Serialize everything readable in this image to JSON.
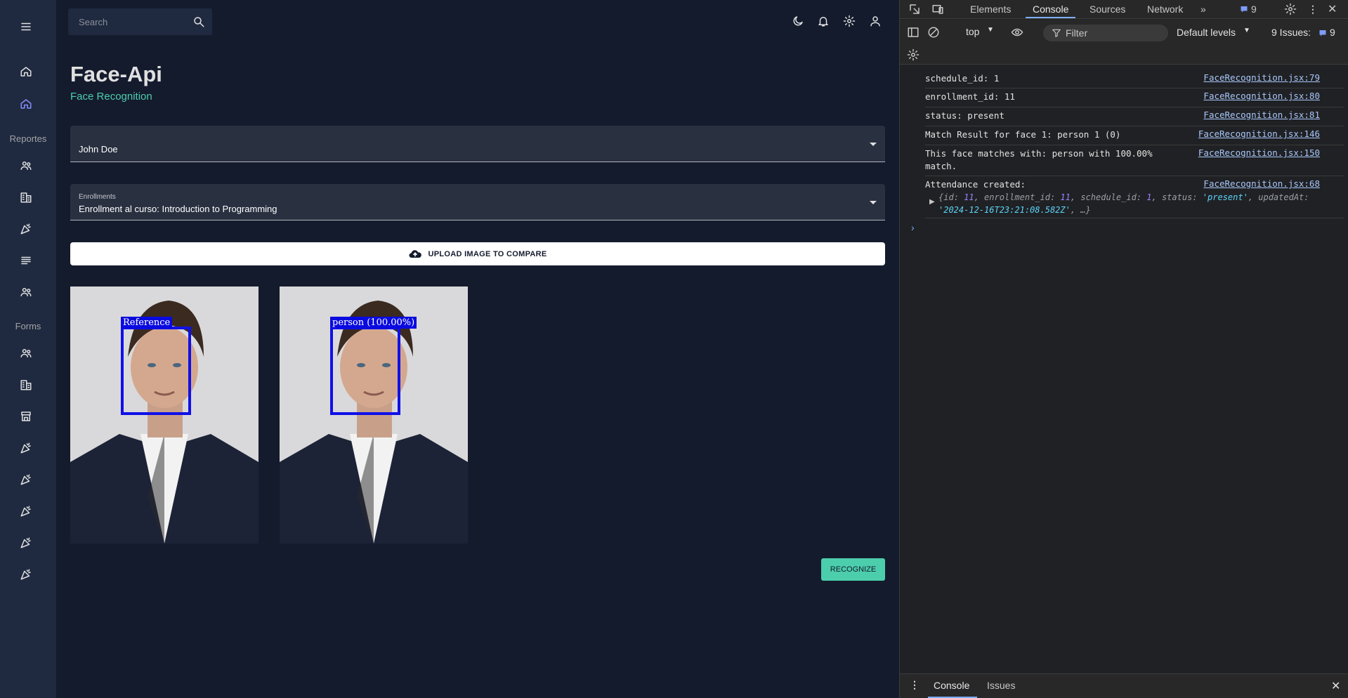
{
  "app": {
    "sidebar": {
      "sections": [
        "Reportes",
        "Forms"
      ],
      "icons": [
        "menu-icon",
        "home-icon",
        "home-icon-active",
        "people-icon",
        "building-icon",
        "celebration-icon",
        "list-icon",
        "people-icon",
        "people-icon",
        "building-icon",
        "storefront-icon",
        "celebration-icon",
        "celebration-icon",
        "celebration-icon",
        "celebration-icon",
        "celebration-icon"
      ]
    },
    "topbar": {
      "search_placeholder": "Search",
      "icons": [
        "dark-mode-icon",
        "notifications-icon",
        "settings-icon",
        "person-icon"
      ]
    },
    "header": {
      "title": "Face-Api",
      "subtitle": "Face Recognition"
    },
    "student_select": {
      "value": "John Doe"
    },
    "enrollment_select": {
      "label": "Enrollments",
      "value": "Enrollment al curso: Introduction to Programming"
    },
    "upload_button": "UPLOAD IMAGE TO COMPARE",
    "images": [
      {
        "tag": "Reference"
      },
      {
        "tag": "person (100.00%)"
      }
    ],
    "recognize_button": "RECOGNIZE"
  },
  "devtools": {
    "tabs": [
      "Elements",
      "Console",
      "Sources",
      "Network"
    ],
    "active_tab": "Console",
    "issues_badge": "9",
    "context": "top",
    "filter_placeholder": "Filter",
    "levels": "Default levels",
    "issues_count": "9 Issues:",
    "issues_num": "9",
    "logs": [
      {
        "text": "schedule_id: 1",
        "source": "FaceRecognition.jsx:79"
      },
      {
        "text": "enrollment_id: 11",
        "source": "FaceRecognition.jsx:80"
      },
      {
        "text": "status: present",
        "source": "FaceRecognition.jsx:81"
      },
      {
        "text": "Match Result for face 1: person 1 (0)",
        "source": "FaceRecognition.jsx:146"
      },
      {
        "text": "This face matches with: person with 100.00%",
        "text2": "match.",
        "source": "FaceRecognition.jsx:150"
      },
      {
        "text": "Attendance created:",
        "source": "FaceRecognition.jsx:68"
      }
    ],
    "object_preview": {
      "id": "11",
      "enrollment_id": "11",
      "schedule_id": "1",
      "status": "'present'",
      "updatedAt": "'2024-12-16T23:21:08.582Z'"
    },
    "drawer_tabs": [
      "Console",
      "Issues"
    ]
  }
}
